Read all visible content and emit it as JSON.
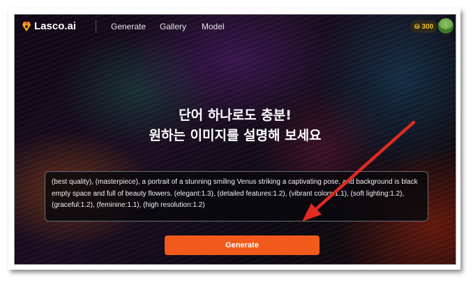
{
  "header": {
    "logo_text": "Lasco.ai",
    "nav": [
      "Generate",
      "Gallery",
      "Model"
    ],
    "credits": "300"
  },
  "main": {
    "headline_line1": "단어 하나로도 충분!",
    "headline_line2": "원하는 이미지를 설명해 보세요",
    "prompt_text": "(best quality), (masterpiece), a portrait of a stunning smiling Venus striking a captivating pose, and background is black empty space and full of beauty flowers. (elegant:1.3), (detailed features:1.2), (vibrant colors:1.1), (soft lighting:1.2), (graceful:1.2), (feminine:1.1), (high resolution:1.2)",
    "generate_label": "Generate"
  },
  "colors": {
    "accent": "#f25a1c",
    "annotation_arrow": "#e02a22",
    "credits_text": "#f3c42a"
  }
}
